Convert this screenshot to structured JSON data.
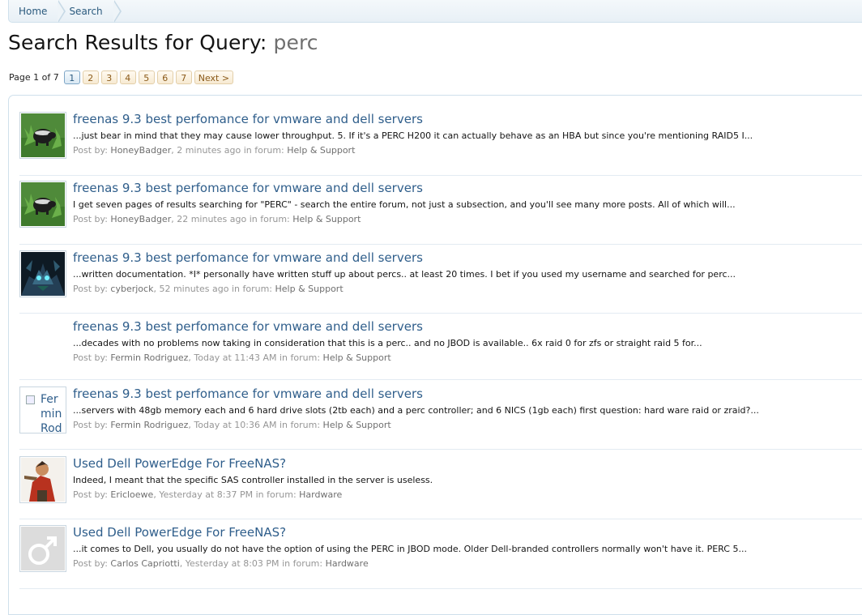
{
  "breadcrumb": {
    "home": "Home",
    "current": "Search"
  },
  "page": {
    "heading_prefix": "Search Results for Query:",
    "query": "perc"
  },
  "pagination": {
    "page_of": "Page 1 of 7",
    "pages": [
      "1",
      "2",
      "3",
      "4",
      "5",
      "6",
      "7"
    ],
    "current": "1",
    "next": "Next >"
  },
  "meta_labels": {
    "post_by": "Post by:",
    "in_forum": "in forum:"
  },
  "results": [
    {
      "title": "freenas 9.3 best perfomance for vmware and dell servers",
      "snippet": "...just bear in mind that they may cause lower throughput. 5. If it's a PERC H200 it can actually behave as an HBA but since you're mentioning RAID5 I...",
      "user": "HoneyBadger",
      "time": "2 minutes ago",
      "forum": "Help & Support",
      "avatar": "honeybadger"
    },
    {
      "title": "freenas 9.3 best perfomance for vmware and dell servers",
      "snippet": "I get seven pages of results searching for \"PERC\" - search the entire forum, not just a subsection, and you'll see many more posts. All of which will...",
      "user": "HoneyBadger",
      "time": "22 minutes ago",
      "forum": "Help & Support",
      "avatar": "honeybadger"
    },
    {
      "title": "freenas 9.3 best perfomance for vmware and dell servers",
      "snippet": "...written documentation. *I* personally have written stuff up about percs.. at least 20 times. I bet if you used my username and searched for perc...",
      "user": "cyberjock",
      "time": "52 minutes ago",
      "forum": "Help & Support",
      "avatar": "cyberjock"
    },
    {
      "title": "freenas 9.3 best perfomance for vmware and dell servers",
      "snippet": "...decades with no problems now taking in consideration that this is a perc.. and no JBOD is available.. 6x raid 0 for zfs or straight raid 5 for...",
      "user": "Fermin Rodriguez",
      "time": "Today at 11:43 AM",
      "forum": "Help & Support",
      "avatar": "none"
    },
    {
      "title": "freenas 9.3 best perfomance for vmware and dell servers",
      "snippet": "...servers with 48gb memory each and 6 hard drive slots (2tb each) and a perc controller; and 6 NICS (1gb each) first question: hard ware raid or zraid?...",
      "user": "Fermin Rodriguez",
      "time": "Today at 10:36 AM",
      "forum": "Help & Support",
      "avatar": "broken",
      "avatar_alt": "Fermin Rodriguez"
    },
    {
      "title": "Used Dell PowerEdge For FreeNAS?",
      "snippet": "Indeed, I meant that the specific SAS controller installed in the server is useless.",
      "user": "Ericloewe",
      "time": "Yesterday at 8:37 PM",
      "forum": "Hardware",
      "avatar": "ericloewe"
    },
    {
      "title": "Used Dell PowerEdge For FreeNAS?",
      "snippet": "...it comes to Dell, you usually do not have the option of using the PERC in JBOD mode. Older Dell-branded controllers normally won't have it. PERC 5...",
      "user": "Carlos Capriotti",
      "time": "Yesterday at 8:03 PM",
      "forum": "Hardware",
      "avatar": "default-male"
    }
  ]
}
